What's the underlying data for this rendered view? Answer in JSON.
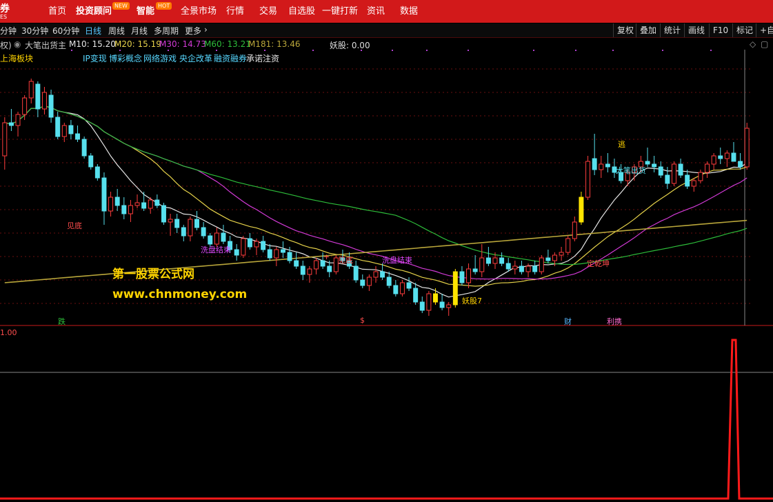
{
  "logo": {
    "line1": "券",
    "line2": "ES"
  },
  "nav": [
    {
      "label": "首页",
      "bold": false
    },
    {
      "label": "投资顾问",
      "bold": true,
      "badge": "NEW"
    },
    {
      "label": "智能",
      "bold": true,
      "badge": "HOT"
    },
    {
      "label": "全景市场",
      "bold": false
    },
    {
      "label": "行情",
      "bold": false
    },
    {
      "label": "交易",
      "bold": false
    },
    {
      "label": "自选股",
      "bold": false
    },
    {
      "label": "一键打新",
      "bold": false
    },
    {
      "label": "资讯",
      "bold": false
    },
    {
      "label": "数据",
      "bold": false
    }
  ],
  "periods": [
    "分钟",
    "30分钟",
    "60分钟",
    "日线",
    "周线",
    "月线",
    "多周期",
    "更多"
  ],
  "active_period": "日线",
  "right_buttons": [
    "复权",
    "叠加",
    "统计",
    "画线",
    "F10",
    "标记",
    "+自"
  ],
  "info": {
    "fq": "权)",
    "indicator": "大笔出货主",
    "ma10": "M10: 15.20",
    "ma20": "M20: 15.19",
    "ma30": "M30: 14.73",
    "ma60": "M60: 13.21",
    "ma181": "M181: 13.46",
    "yaogu": "妖股: 0.00"
  },
  "board_label": "上海板块",
  "concepts": [
    "IP变现",
    "博彩概念",
    "网络游戏",
    "央企改革",
    "融资融券"
  ],
  "concept_overlap": "承诺注资",
  "chart_labels": {
    "jiandi1": "见底",
    "xipan1": "洗盘结束",
    "jiandi2": "见底",
    "xipan2": "洗盘结束",
    "yaogu7": "妖股7",
    "dingqiankun": "定乾坤",
    "tao": "逃",
    "dabichuhuo": "大笔出货",
    "plus_marker": "+"
  },
  "bottom_markers": [
    "跌",
    "$",
    "财",
    "利携"
  ],
  "watermark": {
    "line1": "第一股票公式网",
    "line2": "www.chnmoney.com"
  },
  "sub_panel": {
    "value_label": "1.00"
  },
  "colors": {
    "up": "#ff3d3d",
    "down": "#57e0ee",
    "ma10": "#e6e6e6",
    "ma20": "#e6d24a",
    "ma30": "#d23ad6",
    "ma60": "#2dbd3a",
    "ma181": "#b9a63a",
    "highlight": "#ffe400"
  },
  "chart_data": {
    "type": "candlestick",
    "title": "",
    "ohlc": [
      [
        15.8,
        17.2,
        15.3,
        17.0
      ],
      [
        17.0,
        17.5,
        16.7,
        16.9
      ],
      [
        16.9,
        17.4,
        16.5,
        17.3
      ],
      [
        17.3,
        18.0,
        17.1,
        17.9
      ],
      [
        17.9,
        18.6,
        17.7,
        18.5
      ],
      [
        18.4,
        18.5,
        17.2,
        17.5
      ],
      [
        17.5,
        18.3,
        17.3,
        18.1
      ],
      [
        18.0,
        18.2,
        17.0,
        17.2
      ],
      [
        17.2,
        17.4,
        16.4,
        16.5
      ],
      [
        16.5,
        17.0,
        16.3,
        16.9
      ],
      [
        16.9,
        17.1,
        16.4,
        16.6
      ],
      [
        16.6,
        16.9,
        16.3,
        16.4
      ],
      [
        16.4,
        16.5,
        15.7,
        15.8
      ],
      [
        15.8,
        15.9,
        15.3,
        15.4
      ],
      [
        15.4,
        15.5,
        14.9,
        15.0
      ],
      [
        15.0,
        15.2,
        13.3,
        13.8
      ],
      [
        13.8,
        14.5,
        13.6,
        14.3
      ],
      [
        14.3,
        14.6,
        13.8,
        14.0
      ],
      [
        14.0,
        14.3,
        13.5,
        13.7
      ],
      [
        13.7,
        14.2,
        13.4,
        14.0
      ],
      [
        14.0,
        14.4,
        13.9,
        14.1
      ],
      [
        14.1,
        14.5,
        13.8,
        13.9
      ],
      [
        13.9,
        14.3,
        13.7,
        14.2
      ],
      [
        14.2,
        14.4,
        13.9,
        14.0
      ],
      [
        14.0,
        14.1,
        13.3,
        13.4
      ],
      [
        13.4,
        13.7,
        12.9,
        13.5
      ],
      [
        13.5,
        13.7,
        13.0,
        13.2
      ],
      [
        13.2,
        13.3,
        12.7,
        12.9
      ],
      [
        12.9,
        13.6,
        12.7,
        13.5
      ],
      [
        13.5,
        13.8,
        13.1,
        13.2
      ],
      [
        13.2,
        13.4,
        12.8,
        12.9
      ],
      [
        12.9,
        13.0,
        12.5,
        12.6
      ],
      [
        12.6,
        13.2,
        12.5,
        13.0
      ],
      [
        13.0,
        13.3,
        12.6,
        12.7
      ],
      [
        12.7,
        12.9,
        12.3,
        12.4
      ],
      [
        12.4,
        12.6,
        12.0,
        12.2
      ],
      [
        12.2,
        12.9,
        12.1,
        12.8
      ],
      [
        12.8,
        13.0,
        12.4,
        12.5
      ],
      [
        12.5,
        12.8,
        12.2,
        12.7
      ],
      [
        12.7,
        12.9,
        12.3,
        12.4
      ],
      [
        12.4,
        12.6,
        12.0,
        12.1
      ],
      [
        12.1,
        12.5,
        11.8,
        12.4
      ],
      [
        12.4,
        12.7,
        12.1,
        12.3
      ],
      [
        12.3,
        12.5,
        11.9,
        12.0
      ],
      [
        12.0,
        12.3,
        11.7,
        11.8
      ],
      [
        11.8,
        12.0,
        11.3,
        11.5
      ],
      [
        11.5,
        11.8,
        11.2,
        11.7
      ],
      [
        11.7,
        12.1,
        11.5,
        12.0
      ],
      [
        12.0,
        12.3,
        11.7,
        11.8
      ],
      [
        11.8,
        12.0,
        11.4,
        11.6
      ],
      [
        11.6,
        12.2,
        11.5,
        12.1
      ],
      [
        12.1,
        12.4,
        11.9,
        12.0
      ],
      [
        12.0,
        12.3,
        11.7,
        11.8
      ],
      [
        11.8,
        12.0,
        11.2,
        11.3
      ],
      [
        11.3,
        11.5,
        11.0,
        11.1
      ],
      [
        11.1,
        11.5,
        10.9,
        11.4
      ],
      [
        11.4,
        11.8,
        11.2,
        11.6
      ],
      [
        11.6,
        11.9,
        11.3,
        11.4
      ],
      [
        11.4,
        11.6,
        11.0,
        11.1
      ],
      [
        11.1,
        11.3,
        10.7,
        10.8
      ],
      [
        10.8,
        11.3,
        10.7,
        11.2
      ],
      [
        11.2,
        11.4,
        10.9,
        11.0
      ],
      [
        11.0,
        11.2,
        10.4,
        10.5
      ],
      [
        10.5,
        10.7,
        10.1,
        10.2
      ],
      [
        10.2,
        10.9,
        10.0,
        10.8
      ],
      [
        10.8,
        11.0,
        10.4,
        10.5
      ],
      [
        10.5,
        10.8,
        10.2,
        10.3
      ],
      [
        10.3,
        10.5,
        10.0,
        10.4
      ],
      [
        10.4,
        11.7,
        10.3,
        11.6
      ],
      [
        11.6,
        11.8,
        11.1,
        11.2
      ],
      [
        11.2,
        11.9,
        11.0,
        11.7
      ],
      [
        11.7,
        12.2,
        11.5,
        11.6
      ],
      [
        11.6,
        12.6,
        11.4,
        12.1
      ],
      [
        12.1,
        12.5,
        11.8,
        11.9
      ],
      [
        11.9,
        12.3,
        11.7,
        12.1
      ],
      [
        12.1,
        12.3,
        11.8,
        11.9
      ],
      [
        11.9,
        12.1,
        11.6,
        11.7
      ],
      [
        11.7,
        12.0,
        11.5,
        11.8
      ],
      [
        11.8,
        12.0,
        11.5,
        11.6
      ],
      [
        11.6,
        11.9,
        11.4,
        11.8
      ],
      [
        11.8,
        12.0,
        11.5,
        11.6
      ],
      [
        11.6,
        12.2,
        11.5,
        12.1
      ],
      [
        12.1,
        12.4,
        11.9,
        12.0
      ],
      [
        12.0,
        12.3,
        11.8,
        12.2
      ],
      [
        12.2,
        12.5,
        12.0,
        12.3
      ],
      [
        12.3,
        12.9,
        12.2,
        12.8
      ],
      [
        12.8,
        13.6,
        12.7,
        13.4
      ],
      [
        13.4,
        14.5,
        13.3,
        14.3
      ],
      [
        14.3,
        15.8,
        14.2,
        15.6
      ],
      [
        15.7,
        16.6,
        15.1,
        15.3
      ],
      [
        15.3,
        15.8,
        15.0,
        15.5
      ],
      [
        15.5,
        15.9,
        15.2,
        15.4
      ],
      [
        15.4,
        15.7,
        15.0,
        15.2
      ],
      [
        15.2,
        15.5,
        14.8,
        14.9
      ],
      [
        14.9,
        15.3,
        14.7,
        15.2
      ],
      [
        15.2,
        15.5,
        14.9,
        15.4
      ],
      [
        15.4,
        15.8,
        15.2,
        15.6
      ],
      [
        15.6,
        16.1,
        15.4,
        15.5
      ],
      [
        15.5,
        15.8,
        15.2,
        15.4
      ],
      [
        15.4,
        15.6,
        15.0,
        15.1
      ],
      [
        15.1,
        15.4,
        14.6,
        14.8
      ],
      [
        14.8,
        15.6,
        14.7,
        15.5
      ],
      [
        15.5,
        15.7,
        15.0,
        15.1
      ],
      [
        15.1,
        15.3,
        14.6,
        14.7
      ],
      [
        14.7,
        15.0,
        14.5,
        14.9
      ],
      [
        14.9,
        15.3,
        14.8,
        15.2
      ],
      [
        15.2,
        15.6,
        15.0,
        15.5
      ],
      [
        15.5,
        15.9,
        15.3,
        15.8
      ],
      [
        15.8,
        16.1,
        15.5,
        15.7
      ],
      [
        15.7,
        16.0,
        15.4,
        15.9
      ],
      [
        15.9,
        16.3,
        15.6,
        15.6
      ],
      [
        15.6,
        15.9,
        15.3,
        15.4
      ],
      [
        15.4,
        17.0,
        15.3,
        16.8
      ]
    ],
    "highlight_candles": [
      65,
      68,
      87
    ],
    "ma_names": [
      "M10",
      "M20",
      "M30",
      "M60",
      "M181"
    ],
    "sub_series": {
      "name": "妖股",
      "spike_index": 110,
      "value": 1.0
    }
  }
}
